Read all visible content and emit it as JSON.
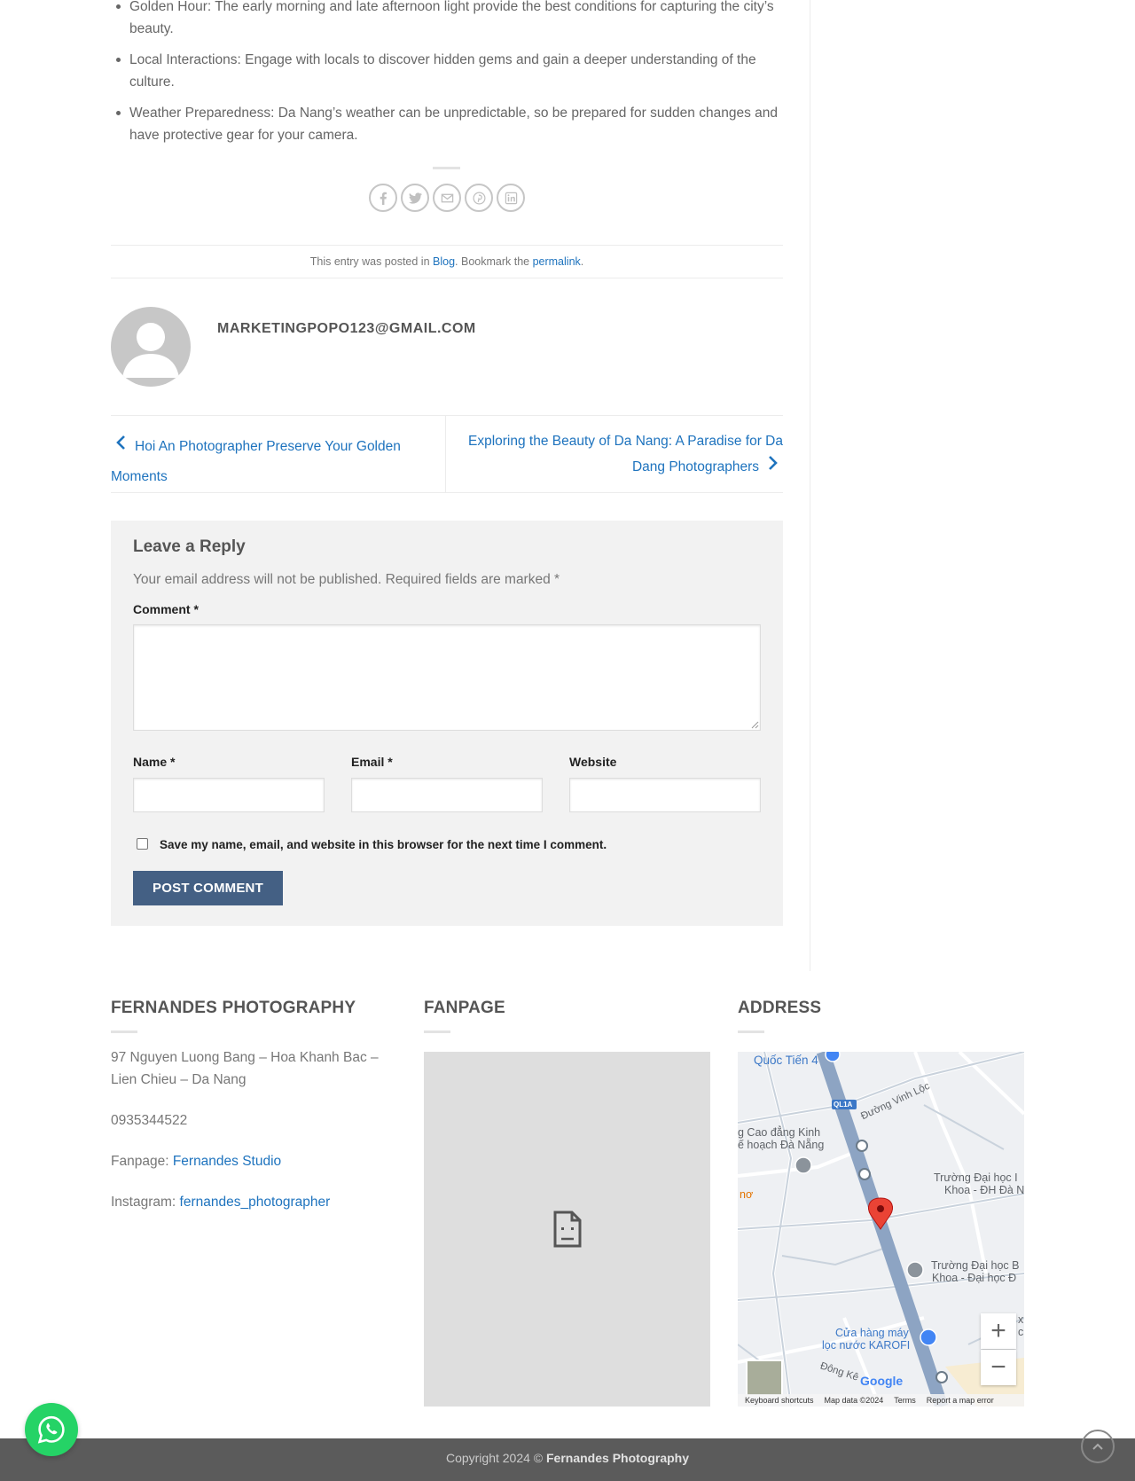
{
  "article": {
    "bullets": [
      "Golden Hour: The early morning and late afternoon light provide the best conditions for capturing the city’s beauty.",
      "Local Interactions: Engage with locals to discover hidden gems and gain a deeper understanding of the culture.",
      "Weather Preparedness: Da Nang’s weather can be unpredictable, so be prepared for sudden changes and have protective gear for your camera."
    ]
  },
  "share_icons": [
    "facebook-icon",
    "twitter-icon",
    "email-icon",
    "pinterest-icon",
    "linkedin-icon"
  ],
  "entry_meta": {
    "prefix": "This entry was posted in ",
    "category": "Blog",
    "middle": ". Bookmark the ",
    "permalink": "permalink",
    "suffix": "."
  },
  "author": {
    "name": "MARKETINGPOPO123@GMAIL.COM"
  },
  "post_nav": {
    "prev": "Hoi An Photographer Preserve Your Golden Moments",
    "next": "Exploring the Beauty of Da Nang: A Paradise for Da Dang Photographers"
  },
  "comment_form": {
    "title": "Leave a Reply",
    "notes": "Your email address will not be published. Required fields are marked *",
    "comment_label": "Comment *",
    "name_label": "Name *",
    "email_label": "Email *",
    "website_label": "Website",
    "save_label": "Save my name, email, and website in this browser for the next time I comment.",
    "submit": "POST COMMENT"
  },
  "footer": {
    "col1_title": "FERNANDES PHOTOGRAPHY",
    "address": "97 Nguyen Luong Bang – Hoa Khanh Bac – Lien Chieu – Da Nang",
    "phone": "0935344522",
    "fanpage_label": "Fanpage: ",
    "fanpage_link": "Fernandes Studio",
    "instagram_label": "Instagram: ",
    "instagram_link": "fernandes_photographer",
    "col2_title": "FANPAGE",
    "col3_title": "ADDRESS"
  },
  "map": {
    "labels": {
      "quoc_tien": "Quốc Tiến 4",
      "ql1a": "QL1A",
      "vinh_loc": "Đường Vinh Lộc",
      "cao_dang_1": "g Cao đẳng Kinh",
      "cao_dang_2": "ế hoạch Đà Nẵng",
      "truong_1a": "Trường Đại học I",
      "truong_1b": "Khoa - ĐH Đà N",
      "truong_2a": "Trường Đại học B",
      "truong_2b": "Khoa - Đại học Đ",
      "karofi_1": "Cửa hàng máy",
      "karofi_2": "lọc nước KAROFI",
      "dong_ke": "Đông Kê",
      "nu": "nơ",
      "x": "x",
      "cl": "cl"
    },
    "google": "Google",
    "footer": {
      "shortcuts": "Keyboard shortcuts",
      "data": "Map data ©2024",
      "terms": "Terms",
      "report": "Report a map error"
    }
  },
  "copyright": {
    "prefix": "Copyright 2024 © ",
    "brand": "Fernandes Photography"
  }
}
